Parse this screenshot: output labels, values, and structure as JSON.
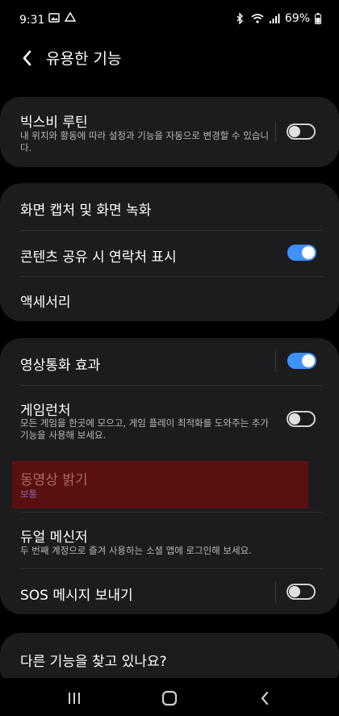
{
  "status_bar": {
    "time": "9:31",
    "notification_icons": [
      "image-icon",
      "drive-icon"
    ],
    "status_icons": [
      "bluetooth-icon",
      "wifi-icon",
      "signal-icon"
    ],
    "battery_text": "69%"
  },
  "header": {
    "back_icon": "chevron-left-icon",
    "title": "유용한 기능"
  },
  "sections": [
    {
      "items": [
        {
          "title": "빅스비 루틴",
          "description": "내 위치와 활동에 따라 설정과 기능을 자동으로 변경할 수 있습니다.",
          "toggle": false
        }
      ]
    },
    {
      "items": [
        {
          "title": "화면 캡처 및 화면 녹화"
        },
        {
          "title": "콘텐츠 공유 시 연락처 표시",
          "toggle": true
        },
        {
          "title": "액세서리"
        }
      ]
    },
    {
      "items": [
        {
          "title": "영상통화 효과",
          "toggle": true
        },
        {
          "title": "게임런처",
          "description": "모든 게임을 한곳에 모으고, 게임 플레이 최적화를 도와주는 추가 기능을 사용해 보세요.",
          "toggle": false
        },
        {
          "title": "동영상 밝기",
          "value": "보통",
          "highlighted": true
        },
        {
          "title": "듀얼 메신저",
          "description": "두 번째 계정으로 즐겨 사용하는 소셜 앱에 로그인해 보세요."
        },
        {
          "title": "SOS 메시지 보내기",
          "toggle": false
        }
      ]
    },
    {
      "items": [
        {
          "title": "다른 기능을 찾고 있나요?"
        }
      ]
    }
  ],
  "navbar": {
    "buttons": [
      "recents-icon",
      "home-icon",
      "back-icon"
    ]
  },
  "colors": {
    "background": "#000000",
    "card": "#1c1c1e",
    "toggle_on": "#3e91ff",
    "highlight": "#5a1010"
  }
}
